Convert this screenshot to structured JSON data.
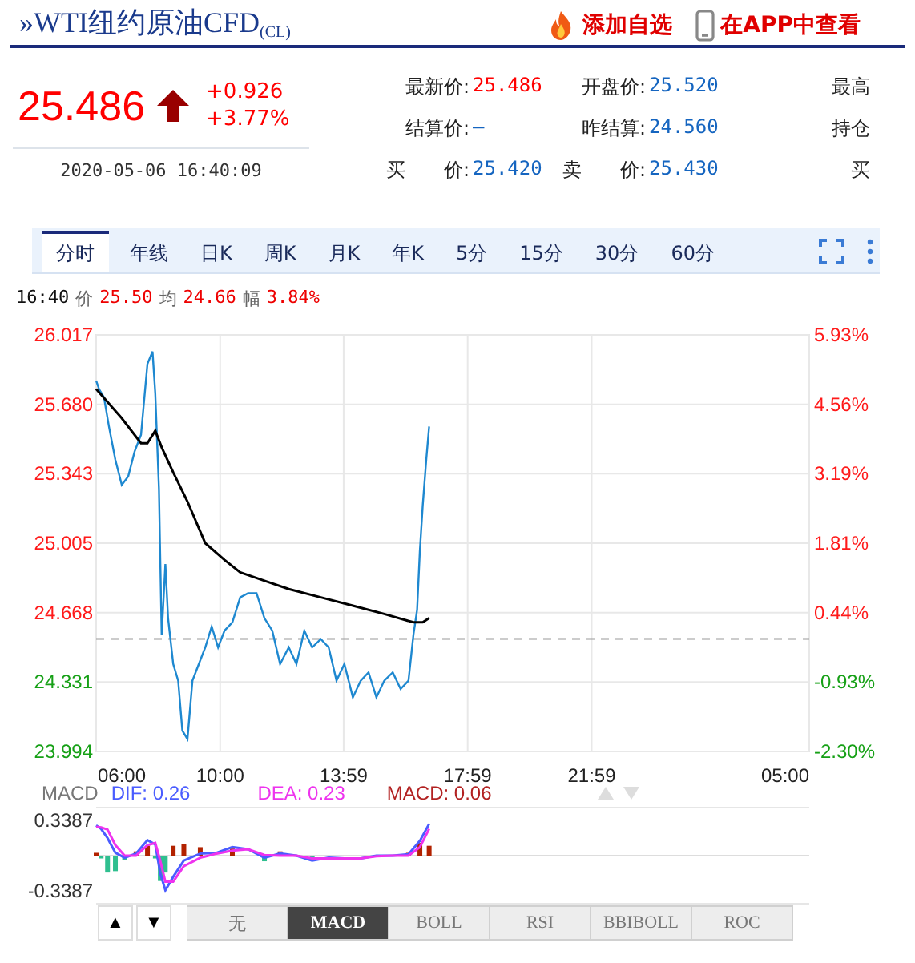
{
  "header": {
    "title": "»WTI纽约原油CFD$_{(CL)}$",
    "actions": [
      {
        "kind": "add",
        "label": "添加自选"
      },
      {
        "kind": "app",
        "label": "在APP中查看"
      }
    ]
  },
  "quote": {
    "price": "25.486",
    "rising": true,
    "change": "+0.926",
    "change_pct": "+3.77%",
    "time": "2020-05-06 16:40:09"
  },
  "fields": [
    [
      {
        "label": "最新价:",
        "value": "25.486",
        "color": "#ff0000"
      },
      {
        "label": "开盘价:",
        "value": "25.520",
        "color": "#1565c0"
      },
      {
        "label": "最高"
      }
    ],
    [
      {
        "label": "结算价:",
        "value": "—",
        "color": "#1565c0"
      },
      {
        "label": "昨结算:",
        "value": "24.560",
        "color": "#1565c0"
      },
      {
        "label": "持仓"
      }
    ],
    [
      {
        "label": "买　　价:",
        "value": "25.420",
        "color": "#1565c0"
      },
      {
        "label": "卖　　价:",
        "value": "25.430",
        "color": "#1565c0"
      },
      {
        "label": "买"
      }
    ]
  ],
  "tabs": [
    {
      "label": "分时",
      "selected": true
    },
    {
      "label": "年线",
      "selected": false
    },
    {
      "label": "日K",
      "selected": false
    },
    {
      "label": "周K",
      "selected": false
    },
    {
      "label": "月K",
      "selected": false
    },
    {
      "label": "年K",
      "selected": false
    },
    {
      "label": "5分",
      "selected": false
    },
    {
      "label": "15分",
      "selected": false
    },
    {
      "label": "30分",
      "selected": false
    },
    {
      "label": "60分",
      "selected": false
    }
  ],
  "info": {
    "time": "16:40",
    "items": [
      {
        "label": "价",
        "value": "25.50"
      },
      {
        "label": "均",
        "value": "24.66"
      },
      {
        "label": "幅",
        "value": "3.84%"
      }
    ]
  },
  "price_chart": {
    "y_labels": [
      {
        "label": "26.017",
        "color": "#ff1a1a"
      },
      {
        "label": "25.680",
        "color": "#ff1a1a"
      },
      {
        "label": "25.343",
        "color": "#ff1a1a"
      },
      {
        "label": "25.005",
        "color": "#ff1a1a"
      },
      {
        "label": "24.668",
        "color": "#ff1a1a"
      },
      {
        "label": "24.331",
        "color": "#16a016"
      },
      {
        "label": "23.994",
        "color": "#16a016"
      }
    ],
    "right_labels": [
      {
        "label": "5.93%",
        "color": "#ff1a1a"
      },
      {
        "label": "4.56%",
        "color": "#ff1a1a"
      },
      {
        "label": "3.19%",
        "color": "#ff1a1a"
      },
      {
        "label": "1.81%",
        "color": "#ff1a1a"
      },
      {
        "label": "0.44%",
        "color": "#ff1a1a"
      },
      {
        "label": "-0.93%",
        "color": "#16a016"
      },
      {
        "label": "-2.30%",
        "color": "#16a016"
      }
    ],
    "time_labels": [
      "06:00",
      "10:00",
      "13:59",
      "17:59",
      "21:59",
      "05:00"
    ]
  },
  "macd": {
    "title": "MACD",
    "legend": [
      {
        "label": "DIF: 0.26",
        "color": "#4a5cff"
      },
      {
        "label": "DEA: 0.23",
        "color": "#ee33ee"
      },
      {
        "label": "MACD: 0.06",
        "color": "#b22222"
      }
    ],
    "y_labels": [
      "0.3387",
      "-0.3387"
    ]
  },
  "pager": [
    "▲",
    "▼"
  ],
  "indicator_tabs": [
    {
      "label": "无",
      "selected": false
    },
    {
      "label": "MACD",
      "selected": true
    },
    {
      "label": "BOLL",
      "selected": false
    },
    {
      "label": "RSI",
      "selected": false
    },
    {
      "label": "BBIBOLL",
      "selected": false
    },
    {
      "label": "ROC",
      "selected": false
    }
  ]
}
